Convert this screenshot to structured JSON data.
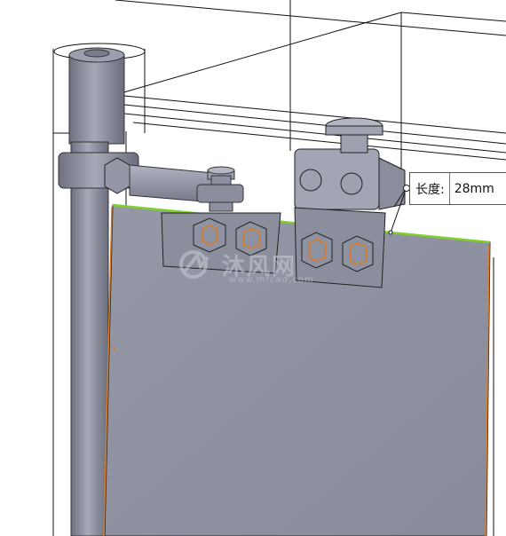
{
  "measurement": {
    "label": "长度:",
    "value": "28mm"
  },
  "watermark": {
    "main_text": "沐风网",
    "url_text": "www.mfcad.com"
  },
  "colors": {
    "plate": "#8f93a2",
    "edge_highlight": "#7fd12a",
    "orange_edge": "#e07a20",
    "wire": "#111111"
  }
}
